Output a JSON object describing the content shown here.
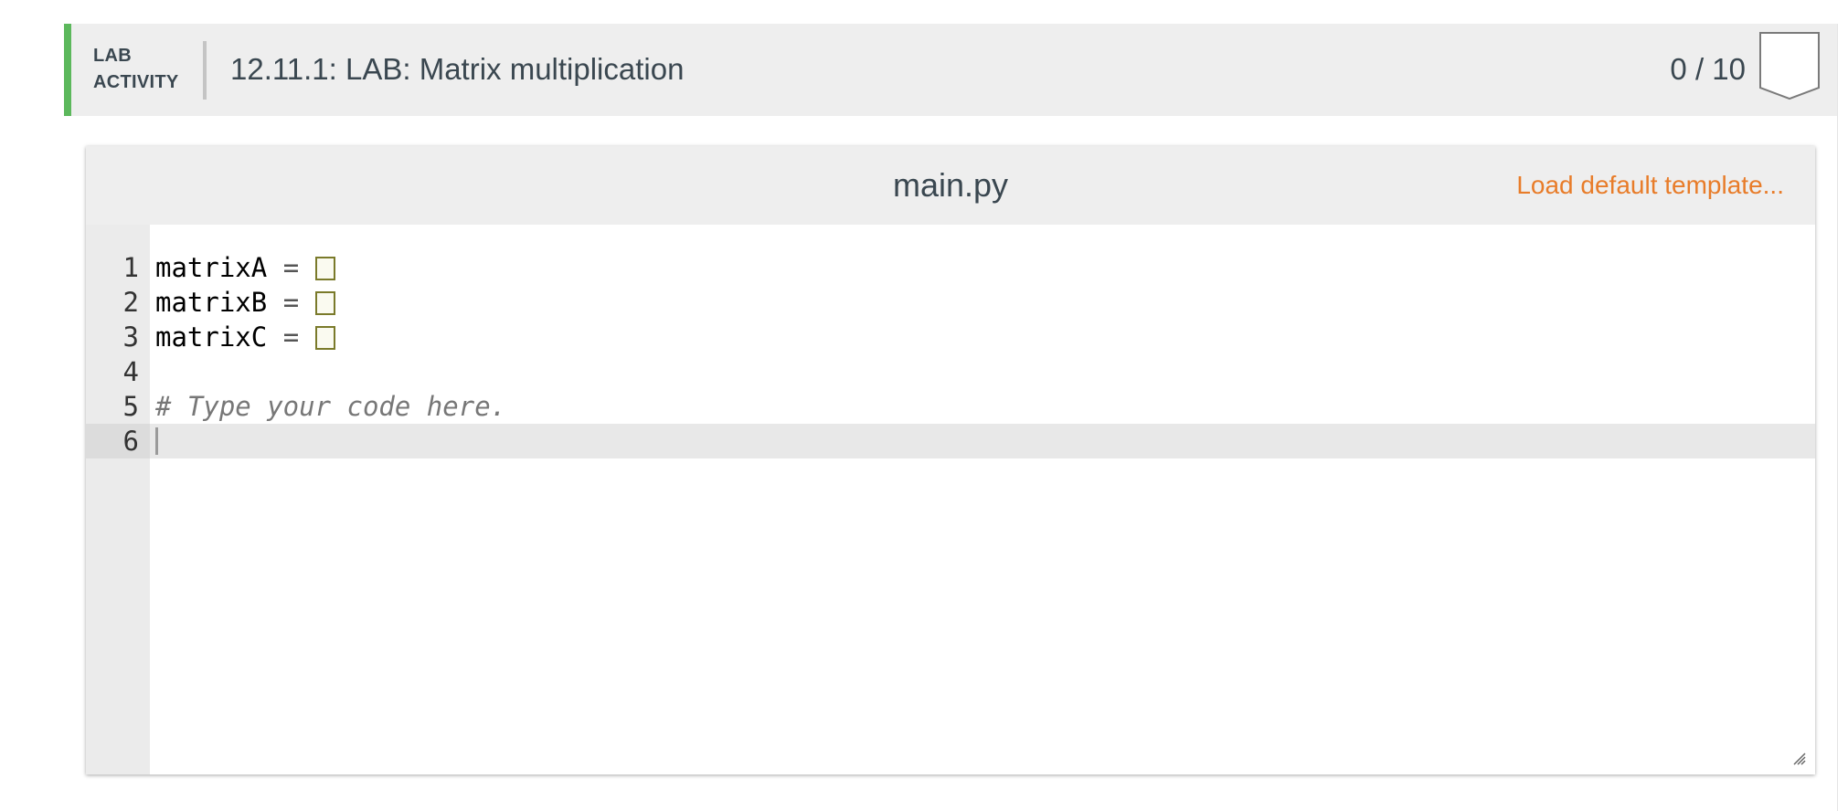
{
  "lab": {
    "label_line1": "LAB",
    "label_line2": "ACTIVITY",
    "title": "12.11.1: LAB: Matrix multiplication",
    "score": "0 / 10",
    "accent_color": "#5cb85c"
  },
  "editor": {
    "file_name": "main.py",
    "load_template": "Load default template...",
    "lines": [
      {
        "num": "1",
        "var": "matrixA",
        "op": "="
      },
      {
        "num": "2",
        "var": "matrixB",
        "op": "="
      },
      {
        "num": "3",
        "var": "matrixC",
        "op": "="
      },
      {
        "num": "4"
      },
      {
        "num": "5",
        "comment": "# Type your code here."
      },
      {
        "num": "6"
      }
    ]
  },
  "icons": {
    "score_badge": "bookmark-badge-icon",
    "resize": "resize-grip-icon"
  }
}
